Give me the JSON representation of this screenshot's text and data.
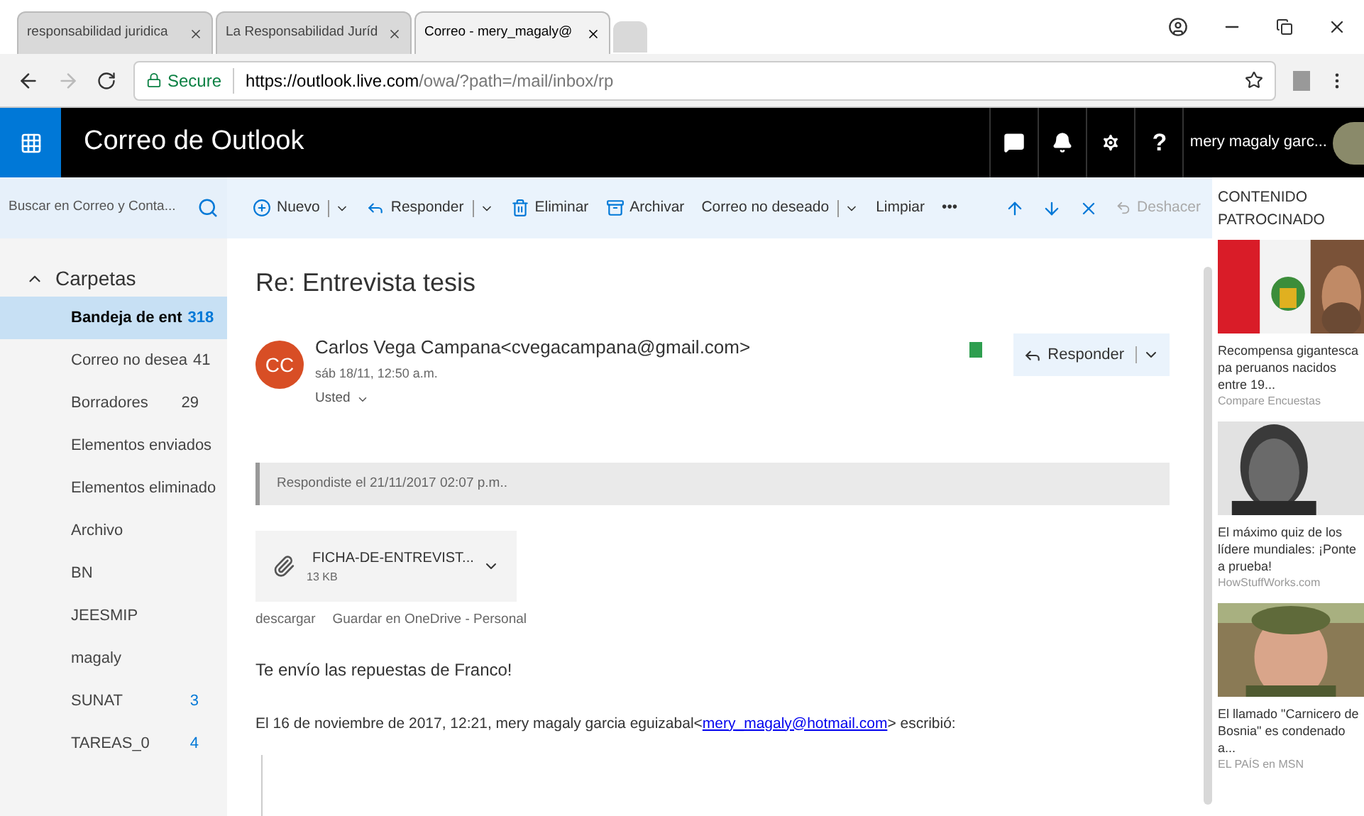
{
  "browser": {
    "tabs": [
      {
        "title": "responsabilidad juridica",
        "selected": false
      },
      {
        "title": "La Responsabilidad Juríd",
        "selected": false
      },
      {
        "title": "Correo - mery_magaly@",
        "selected": true
      }
    ],
    "secure_label": "Secure",
    "url_host": "https://outlook.live.com",
    "url_path": "/owa/?path=/mail/inbox/rp"
  },
  "header": {
    "title": "Correo de Outlook",
    "help": "?",
    "user_name": "mery magaly garc..."
  },
  "search": {
    "placeholder": "Buscar en Correo y Conta..."
  },
  "toolbar": [
    {
      "label": "Nuevo",
      "dropdown": true,
      "disabled": false
    },
    {
      "label": "Responder",
      "dropdown": true,
      "disabled": false
    },
    {
      "label": "Eliminar",
      "dropdown": false,
      "disabled": false
    },
    {
      "label": "Archivar",
      "dropdown": false,
      "disabled": false
    },
    {
      "label": "Correo no deseado",
      "dropdown": true,
      "disabled": false
    },
    {
      "label": "Limpiar",
      "dropdown": false,
      "disabled": false
    },
    {
      "label": "•••",
      "dropdown": false,
      "disabled": false
    }
  ],
  "undo": {
    "label": "Deshacer",
    "disabled": true
  },
  "folders": {
    "title": "Carpetas",
    "expanded": true,
    "items": [
      {
        "name": "Bandeja de ent",
        "count": "318",
        "selected": true
      },
      {
        "name": "Correo no desea",
        "count": "41",
        "selected": false
      },
      {
        "name": "Borradores",
        "count": "29",
        "selected": false
      },
      {
        "name": "Elementos enviados",
        "selected": false
      },
      {
        "name": "Elementos eliminado",
        "selected": false
      },
      {
        "name": "Archivo",
        "selected": false
      },
      {
        "name": "BN",
        "selected": false
      },
      {
        "name": "JEESMIP",
        "selected": false
      },
      {
        "name": "magaly",
        "selected": false
      },
      {
        "name": "SUNAT",
        "count": "3",
        "selected": false
      },
      {
        "name": "TAREAS_0",
        "count": "4",
        "selected": false
      }
    ]
  },
  "message": {
    "subject": "Re: Entrevista tesis",
    "initials": "CC",
    "sender": "Carlos Vega Campana<cvegacampana@gmail.com>",
    "date": "sáb 18/11, 12:50 a.m.",
    "to": "Usted",
    "reply_button": "Responder",
    "replied_note": "Respondiste el 21/11/2017 02:07 p.m..",
    "attachment": {
      "name": "FICHA-DE-ENTREVIST...",
      "size": "13 KB"
    },
    "attachment_actions": [
      "descargar",
      "Guardar en OneDrive - Personal"
    ],
    "body": "Te envío las repuestas de Franco!",
    "quote_prefix": "El 16 de noviembre de 2017, 12:21, mery magaly garcia eguizabal<",
    "quote_link": "mery_magaly@hotmail.com",
    "quote_suffix": "> escribió:"
  },
  "sponsored": {
    "title": "CONTENIDO PATROCINADO",
    "ads": [
      {
        "headline": "Recompensa gigantesca pa peruanos nacidos entre 19...",
        "source": "Compare Encuestas"
      },
      {
        "headline": "El máximo quiz de los lídere mundiales: ¡Ponte a prueba!",
        "source": "HowStuffWorks.com"
      },
      {
        "headline": "El llamado \"Carnicero de Bosnia\" es condenado a...",
        "source": "EL PAÍS en MSN"
      }
    ]
  }
}
